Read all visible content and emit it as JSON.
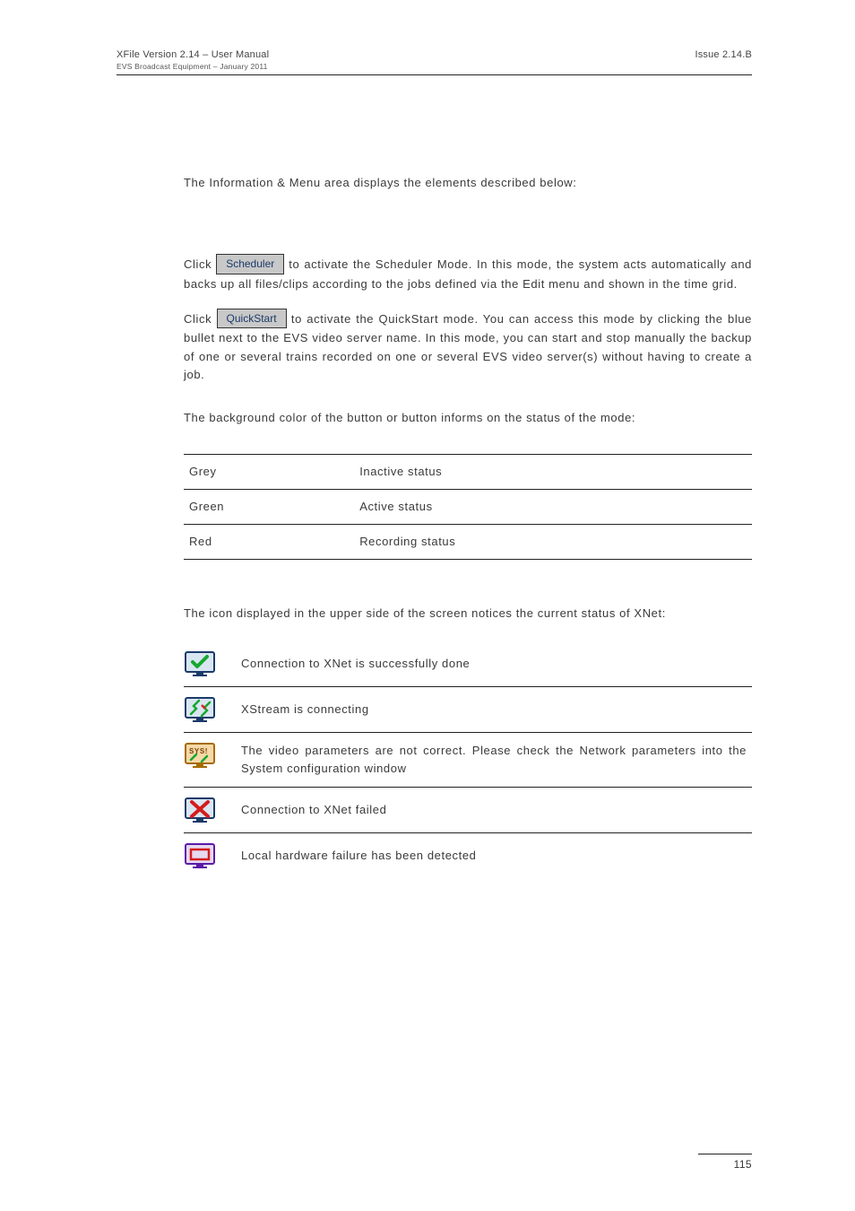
{
  "header": {
    "title": "XFile Version 2.14 – User Manual",
    "sub": "EVS Broadcast Equipment – January 2011",
    "issue": "Issue 2.14.B"
  },
  "intro": "The Information & Menu area displays the elements described below:",
  "scheduler": {
    "prefix": "Click ",
    "button": "Scheduler",
    "rest": " to activate the Scheduler Mode. In this mode, the system acts automatically and backs up all files/clips according to the jobs defined via the Edit menu and shown in the time grid."
  },
  "quickstart": {
    "prefix": "Click ",
    "button": "QuickStart",
    "rest": " to activate the QuickStart mode. You can access this mode by clicking the blue bullet next to the EVS video server name. In this mode, you can start and stop manually the backup of one or several trains recorded on one or several EVS video server(s) without having to create a job."
  },
  "bgtext": {
    "p1": "The background color of the ",
    "p2": " button or ",
    "p3": " button informs on the status of the mode:"
  },
  "status_rows": [
    {
      "c": "Grey",
      "s": "Inactive status"
    },
    {
      "c": "Green",
      "s": "Active status"
    },
    {
      "c": "Red",
      "s": "Recording status"
    }
  ],
  "xnet_intro": "The icon displayed in the upper side of the screen notices the current status of XNet:",
  "xnet_rows": [
    {
      "icon": "ok",
      "t": "Connection to XNet is successfully done"
    },
    {
      "icon": "connecting",
      "t": "XStream is connecting"
    },
    {
      "icon": "sys",
      "t": "The video parameters are not correct. Please check the Network parameters into the System configuration window"
    },
    {
      "icon": "fail",
      "t": "Connection to XNet failed"
    },
    {
      "icon": "hw",
      "t": "Local hardware failure has been detected"
    }
  ],
  "page_number": "115"
}
